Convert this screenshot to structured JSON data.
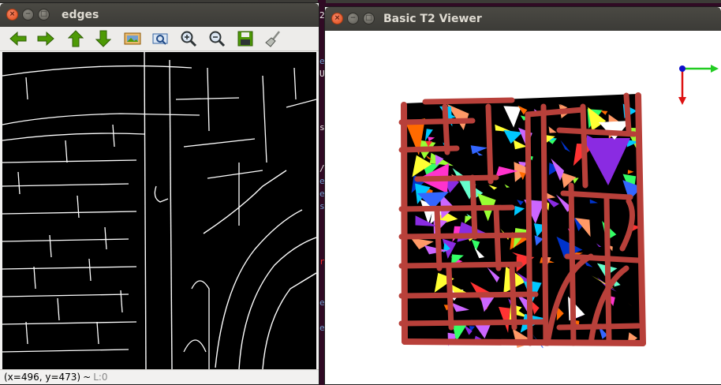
{
  "terminal": {
    "background": "#300a24",
    "glyphs": [
      "2",
      "e",
      "U",
      "s",
      "/",
      "e",
      "e",
      "s",
      "r",
      "e",
      "e"
    ]
  },
  "edges_window": {
    "title": "edges",
    "toolbar": {
      "items": [
        {
          "name": "pan-left",
          "icon": "arrow-left-icon"
        },
        {
          "name": "pan-right",
          "icon": "arrow-right-icon"
        },
        {
          "name": "pan-up",
          "icon": "arrow-up-icon"
        },
        {
          "name": "pan-down",
          "icon": "arrow-down-icon"
        },
        {
          "name": "fit-window",
          "icon": "image-icon"
        },
        {
          "name": "zoom-in-original",
          "icon": "zoom-original-icon"
        },
        {
          "name": "zoom-in",
          "icon": "zoom-in-icon"
        },
        {
          "name": "zoom-out",
          "icon": "zoom-out-icon"
        },
        {
          "name": "save",
          "icon": "save-icon"
        },
        {
          "name": "properties",
          "icon": "broom-icon"
        }
      ]
    },
    "status": {
      "coords": "(x=496, y=473)",
      "separator": "~",
      "level": "L:0"
    }
  },
  "t2_window": {
    "title": "Basic T2 Viewer",
    "axes": {
      "x_color": "#22cc22",
      "y_color": "#dd1111",
      "origin_color": "#1010cc"
    },
    "mesh_outline_color": "#b8403a"
  },
  "colors": {
    "titlebar": "#3c3b37",
    "close_button": "#df4a16",
    "title_text": "#dfdbd2",
    "arrow_green": "#3f9a1e",
    "edges_canvas": "#000000",
    "t2_canvas": "#ffffff"
  }
}
